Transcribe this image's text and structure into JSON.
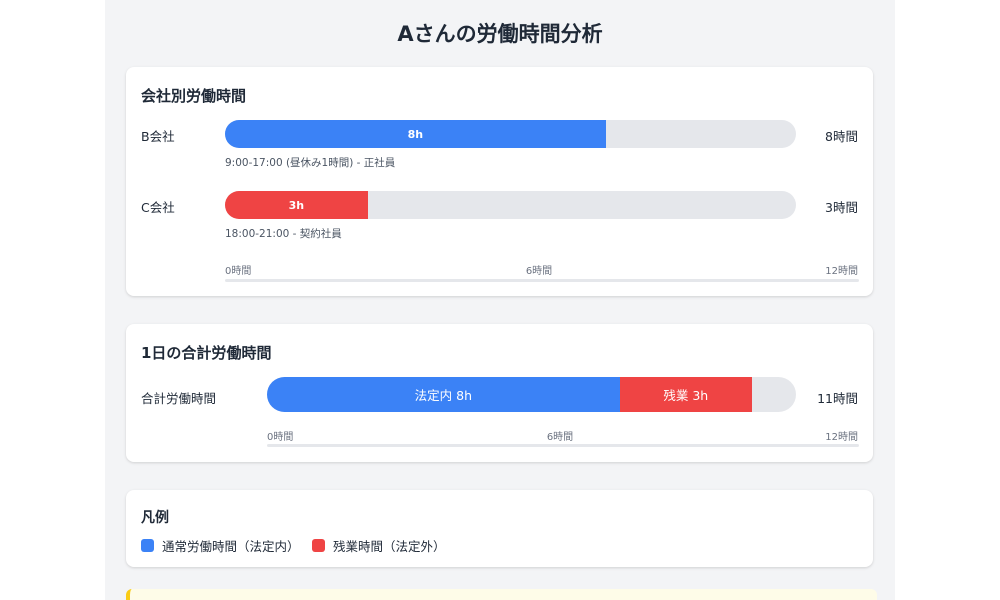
{
  "title": "Aさんの労働時間分析",
  "colors": {
    "regular": "#3b82f6",
    "overtime": "#ef4444",
    "track": "#e5e7eb",
    "notice": "#facc15"
  },
  "chart_data": [
    {
      "type": "bar",
      "title": "会社別労働時間",
      "categories": [
        "B会社",
        "C会社"
      ],
      "values": [
        8,
        3
      ],
      "bar_labels": [
        "8h",
        "3h"
      ],
      "value_labels": [
        "8時間",
        "3時間"
      ],
      "notes": [
        "9:00-17:00 (昼休み1時間) - 正社員",
        "18:00-21:00 - 契約社員"
      ],
      "bar_colors": [
        "#3b82f6",
        "#ef4444"
      ],
      "xlim": [
        0,
        12
      ],
      "ticks": [
        0,
        6,
        12
      ],
      "tick_labels": [
        "0時間",
        "6時間",
        "12時間"
      ]
    },
    {
      "type": "bar",
      "stacked": true,
      "title": "1日の合計労働時間",
      "categories": [
        "合計労働時間"
      ],
      "series": [
        {
          "name": "法定内",
          "values": [
            8
          ],
          "label": "法定内 8h",
          "color": "#3b82f6"
        },
        {
          "name": "残業",
          "values": [
            3
          ],
          "label": "残業 3h",
          "color": "#ef4444"
        }
      ],
      "total_label": "11時間",
      "xlim": [
        0,
        12
      ],
      "ticks": [
        0,
        6,
        12
      ],
      "tick_labels": [
        "0時間",
        "6時間",
        "12時間"
      ]
    }
  ],
  "legend": {
    "title": "凡例",
    "items": [
      {
        "label": "通常労働時間（法定内）",
        "color": "#3b82f6"
      },
      {
        "label": "残業時間（法定外）",
        "color": "#ef4444"
      }
    ]
  }
}
